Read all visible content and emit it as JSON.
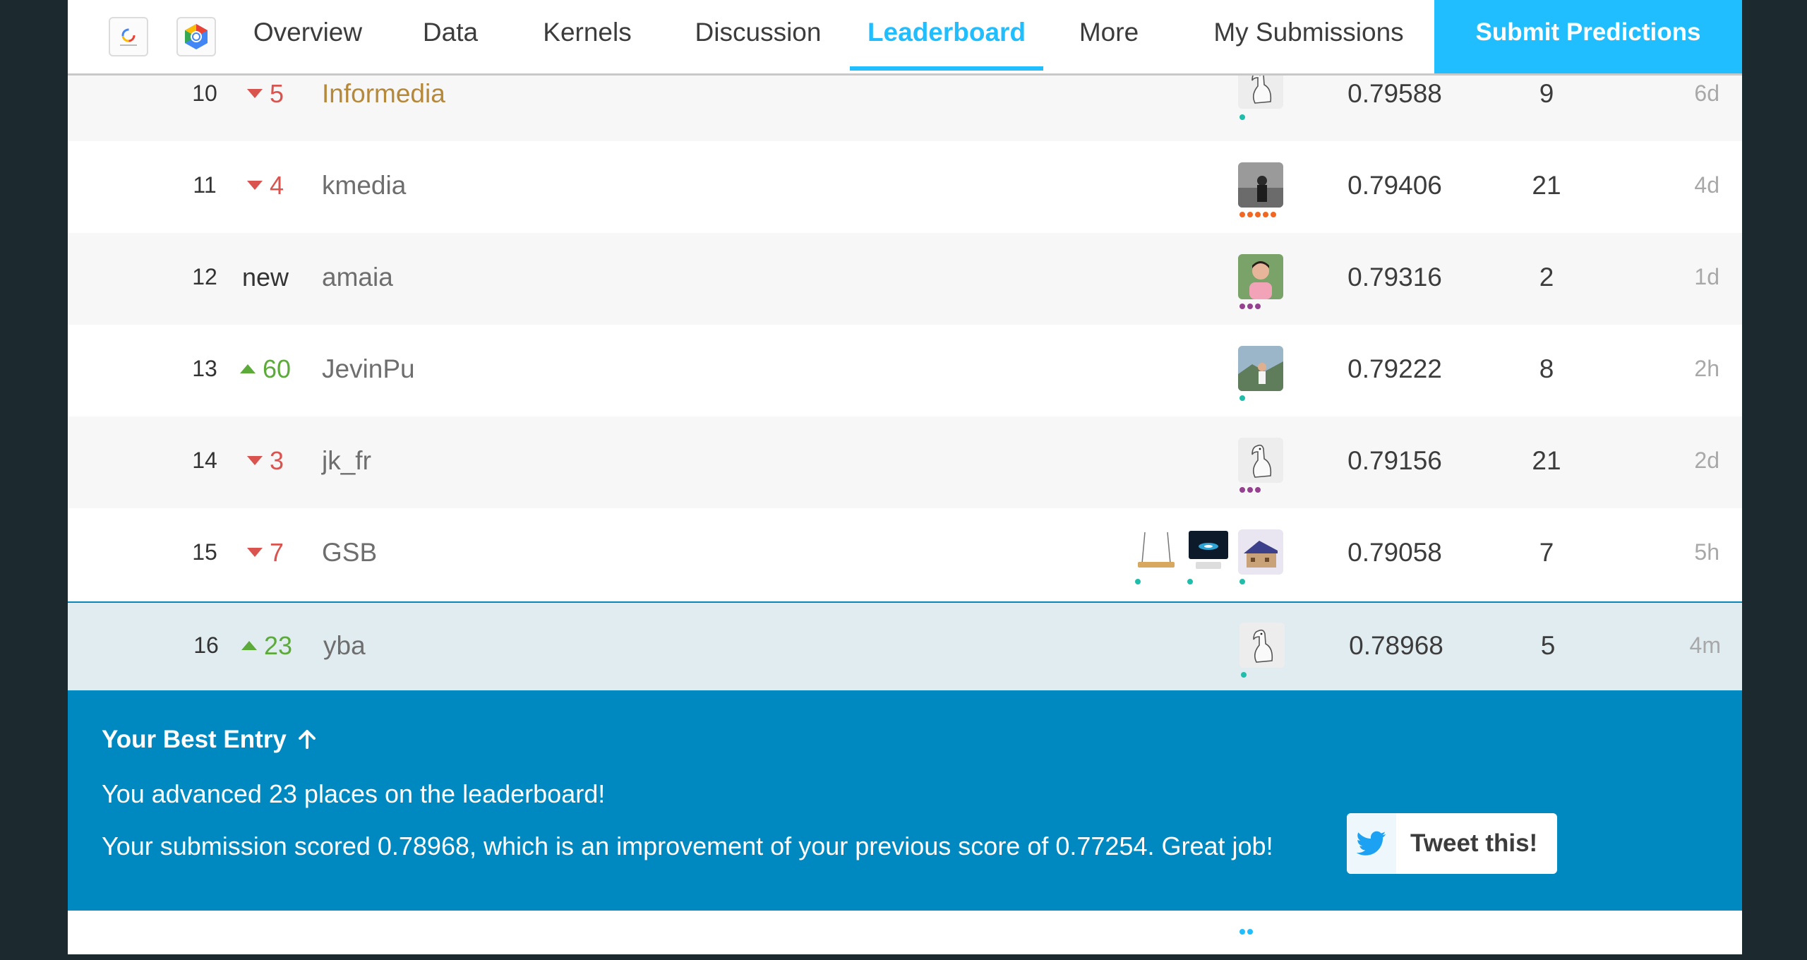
{
  "nav": {
    "tabs": [
      {
        "label": "Overview"
      },
      {
        "label": "Data"
      },
      {
        "label": "Kernels"
      },
      {
        "label": "Discussion"
      },
      {
        "label": "Leaderboard"
      },
      {
        "label": "More"
      }
    ],
    "my_submissions": "My Submissions",
    "submit": "Submit Predictions",
    "active_tab": "Leaderboard"
  },
  "leaderboard": {
    "rows": [
      {
        "rank": "10",
        "delta": "5",
        "direction": "down",
        "team": "Informedia",
        "score": "0.79588",
        "entries": "9",
        "last": "6d"
      },
      {
        "rank": "11",
        "delta": "4",
        "direction": "down",
        "team": "kmedia",
        "score": "0.79406",
        "entries": "21",
        "last": "4d"
      },
      {
        "rank": "12",
        "delta": "new",
        "direction": "new",
        "team": "amaia",
        "score": "0.79316",
        "entries": "2",
        "last": "1d"
      },
      {
        "rank": "13",
        "delta": "60",
        "direction": "up",
        "team": "JevinPu",
        "score": "0.79222",
        "entries": "8",
        "last": "2h"
      },
      {
        "rank": "14",
        "delta": "3",
        "direction": "down",
        "team": "jk_fr",
        "score": "0.79156",
        "entries": "21",
        "last": "2d"
      },
      {
        "rank": "15",
        "delta": "7",
        "direction": "down",
        "team": "GSB",
        "score": "0.79058",
        "entries": "7",
        "last": "5h"
      },
      {
        "rank": "16",
        "delta": "23",
        "direction": "up",
        "team": "yba",
        "score": "0.78968",
        "entries": "5",
        "last": "4m"
      }
    ]
  },
  "banner": {
    "title": "Your Best Entry",
    "line1": "You advanced 23 places on the leaderboard!",
    "line2": "Your submission scored 0.78968, which is an improvement of your previous score of 0.77254. Great job!",
    "tweet": "Tweet this!"
  },
  "colors": {
    "accent": "#20beff",
    "banner": "#0088c0",
    "up": "#5cab3a",
    "down": "#d9534f"
  }
}
